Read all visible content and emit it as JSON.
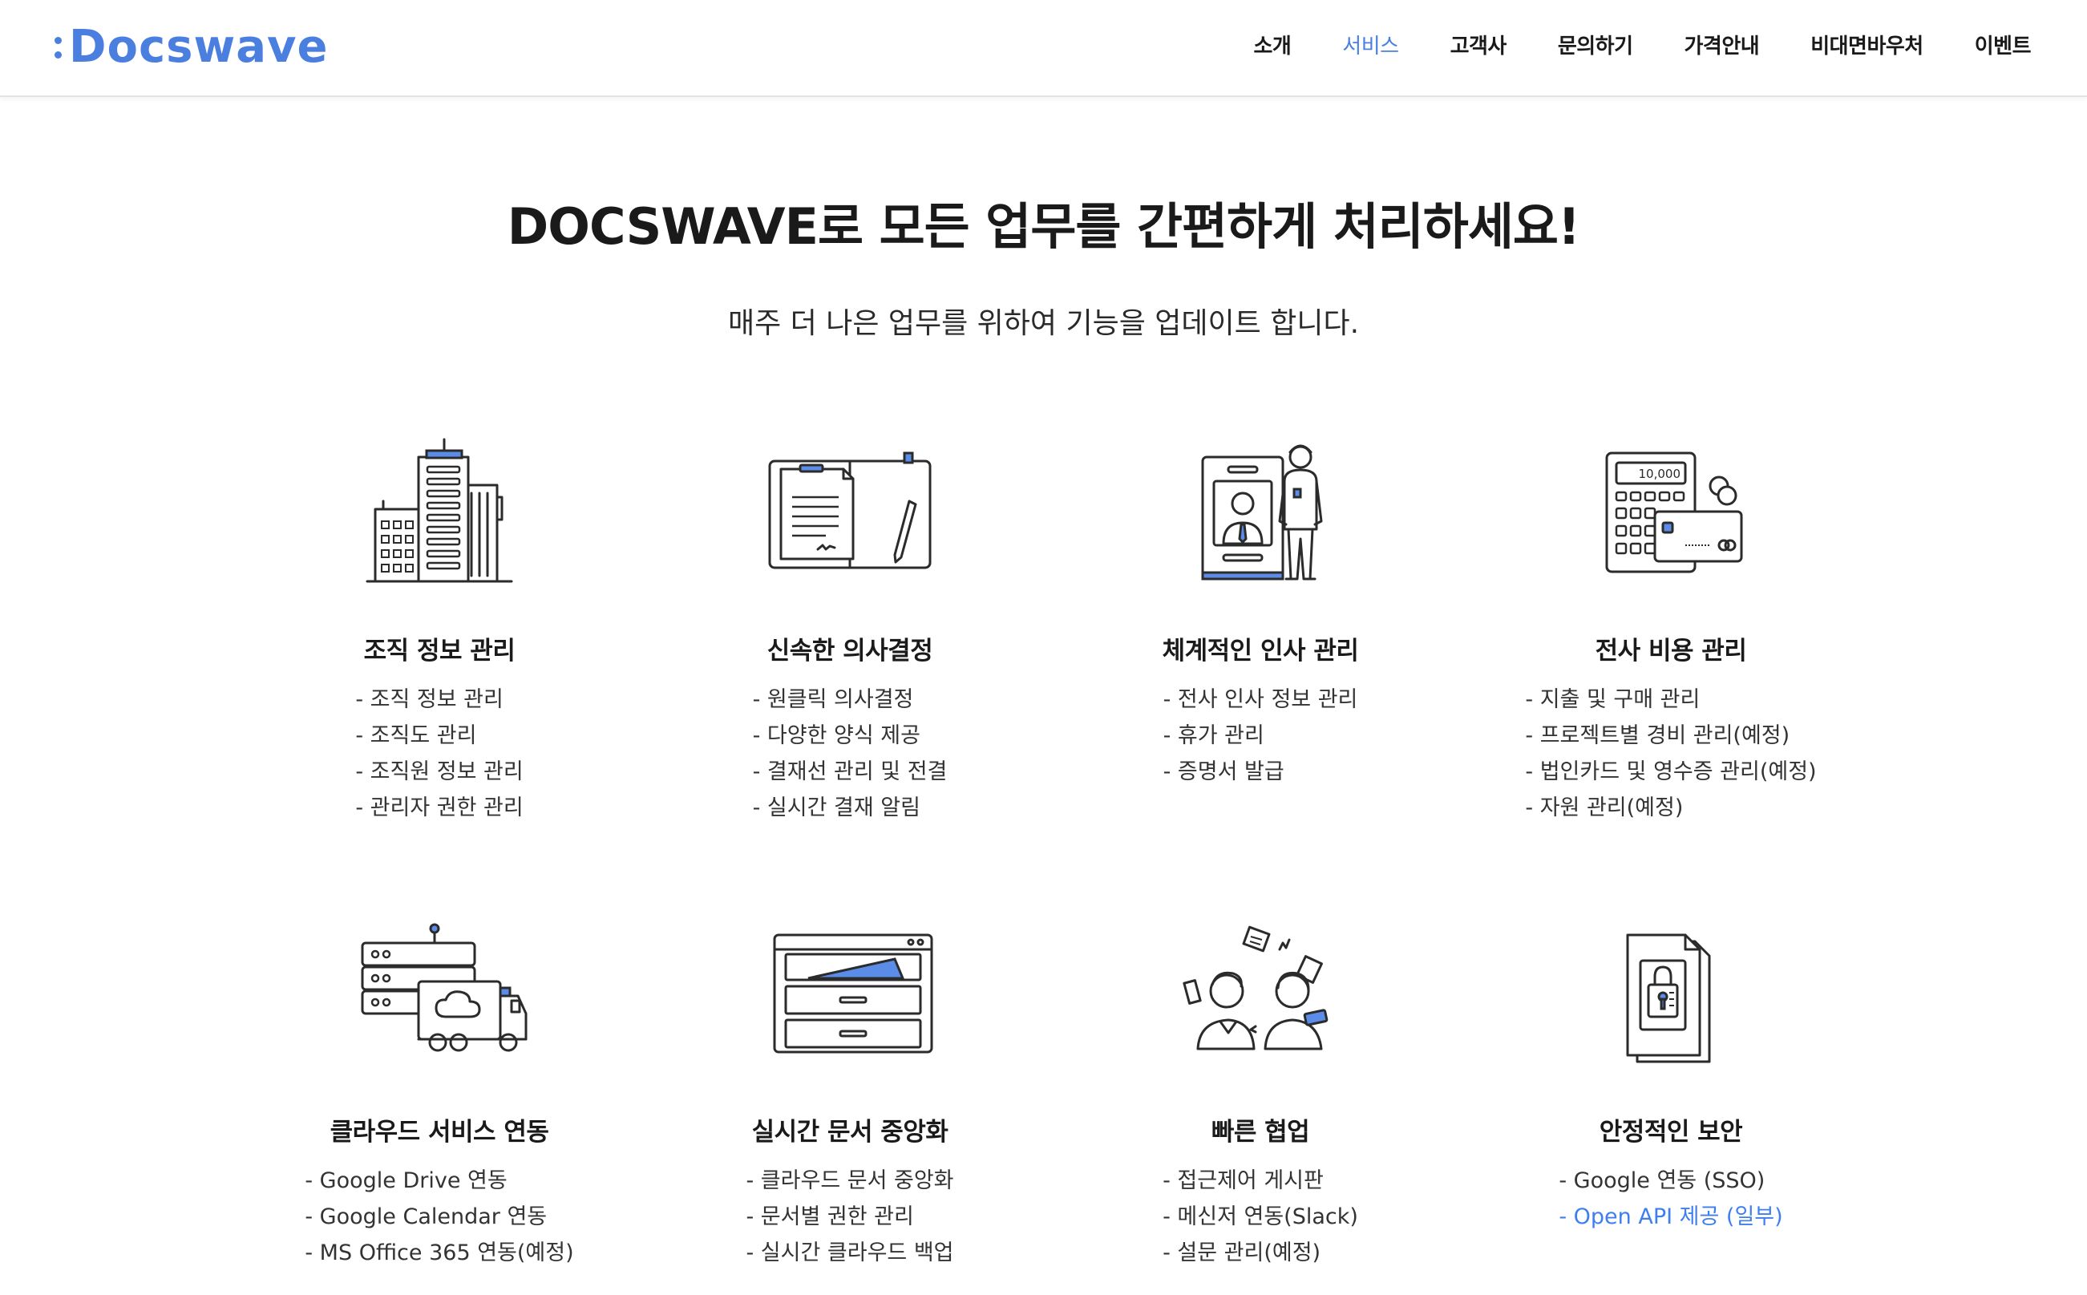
{
  "header": {
    "logo_text": "Docswave",
    "nav": [
      "소개",
      "서비스",
      "고객사",
      "문의하기",
      "가격안내",
      "비대면바우처",
      "이벤트"
    ],
    "active_nav": "서비스"
  },
  "hero": {
    "title": "DOCSWAVE로 모든 업무를 간편하게 처리하세요!",
    "subtitle": "매주 더 나은 업무를 위하여 기능을 업데이트 합니다."
  },
  "colors": {
    "accent": "#4a7fe0",
    "link": "#3f7ef0",
    "text": "#1a1a1a"
  },
  "features": [
    {
      "icon": "buildings-icon",
      "title": "조직 정보 관리",
      "items": [
        "- 조직 정보 관리",
        "- 조직도 관리",
        "- 조직원 정보 관리",
        "- 관리자 권한 관리"
      ]
    },
    {
      "icon": "document-folder-icon",
      "title": "신속한 의사결정",
      "items": [
        "- 원클릭 의사결정",
        "- 다양한 양식 제공",
        "- 결재선 관리 및 전결",
        "- 실시간 결재 알림"
      ]
    },
    {
      "icon": "id-card-person-icon",
      "title": "체계적인 인사 관리",
      "items": [
        "- 전사 인사 정보 관리",
        "- 휴가 관리",
        "- 증명서 발급"
      ]
    },
    {
      "icon": "calculator-card-icon",
      "title": "전사 비용 관리",
      "items": [
        "- 지출 및 구매 관리",
        "- 프로젝트별 경비 관리(예정)",
        "- 법인카드 및 영수증 관리(예정)",
        "- 자원 관리(예정)"
      ]
    },
    {
      "icon": "server-cloud-truck-icon",
      "title": "클라우드 서비스 연동",
      "items": [
        "- Google Drive 연동",
        "- Google Calendar 연동",
        "- MS Office 365 연동(예정)"
      ]
    },
    {
      "icon": "file-cabinet-icon",
      "title": "실시간 문서 중앙화",
      "items": [
        "- 클라우드 문서 중앙화",
        "- 문서별 권한 관리",
        "- 실시간 클라우드 백업"
      ]
    },
    {
      "icon": "collaborating-people-icon",
      "title": "빠른 협업",
      "items": [
        "- 접근제어 게시판",
        "- 메신저 연동(Slack)",
        "- 설문 관리(예정)"
      ]
    },
    {
      "icon": "locked-document-icon",
      "title": "안정적인 보안",
      "items": [
        "- Google 연동 (SSO)",
        "- Open API 제공 (일부)"
      ]
    }
  ],
  "calculator_display": "10,000"
}
